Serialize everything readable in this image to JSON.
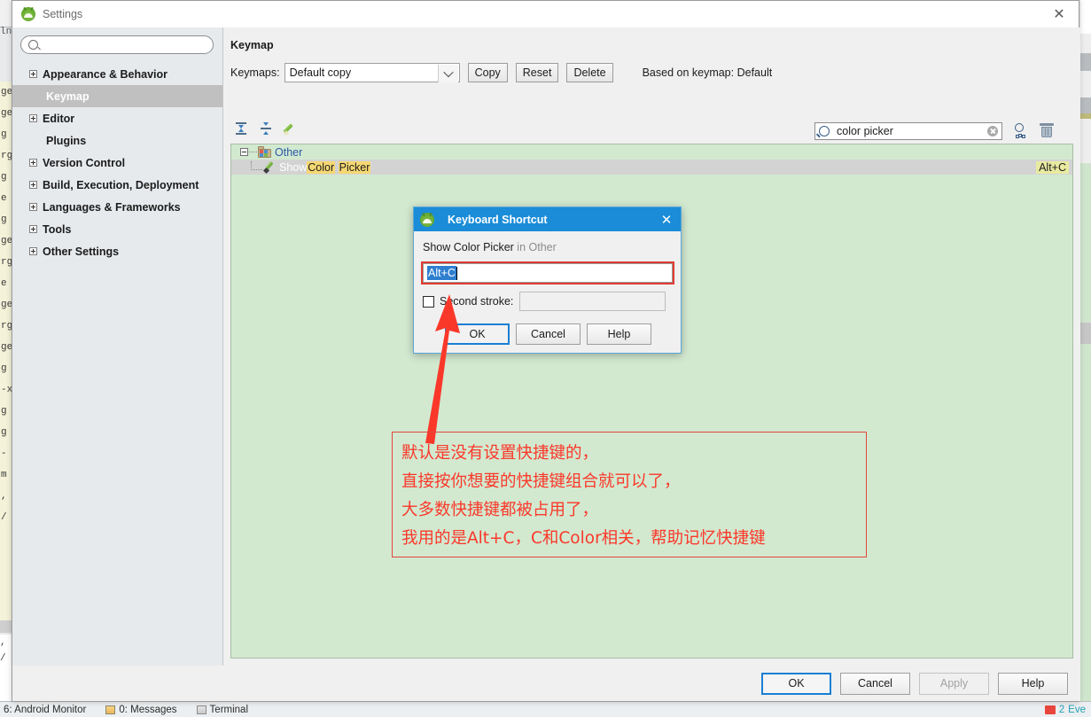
{
  "ide": {
    "statusbar": {
      "left_items": [
        {
          "label": "6: Android Monitor",
          "icon": ""
        },
        {
          "label": "0: Messages",
          "icon": "messages-icon"
        },
        {
          "label": "Terminal",
          "icon": "terminal-icon"
        }
      ],
      "right": {
        "error_count": "2",
        "label": "Eve"
      }
    },
    "editor_fragments": [
      "ge",
      "ge",
      "g",
      "rg",
      "g",
      "e",
      "g",
      "ge",
      "rg",
      "e",
      "ge",
      "rg",
      "ge",
      "g",
      "-x",
      "g",
      "g",
      "-",
      "m",
      ",",
      "/"
    ]
  },
  "window": {
    "title": "Settings",
    "icon": "android-studio-icon",
    "close_label": "✕"
  },
  "sidebar": {
    "search": {
      "value": "",
      "placeholder": "",
      "icon": "search-icon"
    },
    "items": [
      {
        "label": "Appearance & Behavior",
        "expandable": true,
        "selected": false,
        "child": false
      },
      {
        "label": "Keymap",
        "expandable": false,
        "selected": true,
        "child": true
      },
      {
        "label": "Editor",
        "expandable": true,
        "selected": false,
        "child": false
      },
      {
        "label": "Plugins",
        "expandable": false,
        "selected": false,
        "child": false
      },
      {
        "label": "Version Control",
        "expandable": true,
        "selected": false,
        "child": false
      },
      {
        "label": "Build, Execution, Deployment",
        "expandable": true,
        "selected": false,
        "child": false
      },
      {
        "label": "Languages & Frameworks",
        "expandable": true,
        "selected": false,
        "child": false
      },
      {
        "label": "Tools",
        "expandable": true,
        "selected": false,
        "child": false
      },
      {
        "label": "Other Settings",
        "expandable": true,
        "selected": false,
        "child": false
      }
    ]
  },
  "main": {
    "heading": "Keymap",
    "keymaps_label": "Keymaps:",
    "keymap_selected": "Default copy",
    "copy_label": "Copy",
    "reset_label": "Reset",
    "delete_label": "Delete",
    "based_on": "Based on keymap: Default",
    "toolbar": {
      "expand_all": "expand-all-icon",
      "collapse_all": "collapse-all-icon",
      "edit_shortcut": "edit-pencil-icon"
    },
    "action_search": {
      "value": "color picker",
      "placeholder": "",
      "icon": "search-actions-icon",
      "clear": "clear-icon"
    },
    "filter_by_shortcut_icon": "filter-by-shortcut-icon",
    "clear_filter_icon": "trash-icon",
    "tree": {
      "group": {
        "label": "Other",
        "icon": "folder-icon",
        "expanded": true
      },
      "rows": [
        {
          "prefix": "Show ",
          "highlight_1": "Color",
          "mid": " ",
          "highlight_2": "Picker",
          "full_label": "Show Color Picker",
          "icon": "color-picker-icon",
          "shortcut": "Alt+C",
          "selected": true
        }
      ]
    }
  },
  "footer": {
    "ok": "OK",
    "cancel": "Cancel",
    "apply": "Apply",
    "help": "Help"
  },
  "dialog": {
    "title": "Keyboard Shortcut",
    "icon": "android-studio-icon",
    "close_label": "✕",
    "subtitle_action": "Show Color Picker",
    "subtitle_in": " in Other",
    "shortcut_value": "Alt+C",
    "second_stroke_label": "Second stroke:",
    "second_stroke_checked": false,
    "second_stroke_value": "",
    "ok": "OK",
    "cancel": "Cancel",
    "help": "Help"
  },
  "annotation": {
    "color": "#fa382a",
    "box_border": "#e0453a",
    "lines": [
      "默认是没有设置快捷键的，",
      "直接按你想要的快捷键组合就可以了，",
      "大多数快捷键都被占用了，",
      "我用的是Alt+C，C和Color相关，帮助记忆快捷键"
    ],
    "arrow": "red-arrow-annotation"
  },
  "colors": {
    "tree_background": "#d2e9d0",
    "dialog_titlebar": "#1a8cd8",
    "selection_blue": "#2f7fd0",
    "highlight_yellow": "#f6d872",
    "shortcut_cell": "#e8eaa0",
    "sidebar_selected": "#c0c0c0"
  }
}
